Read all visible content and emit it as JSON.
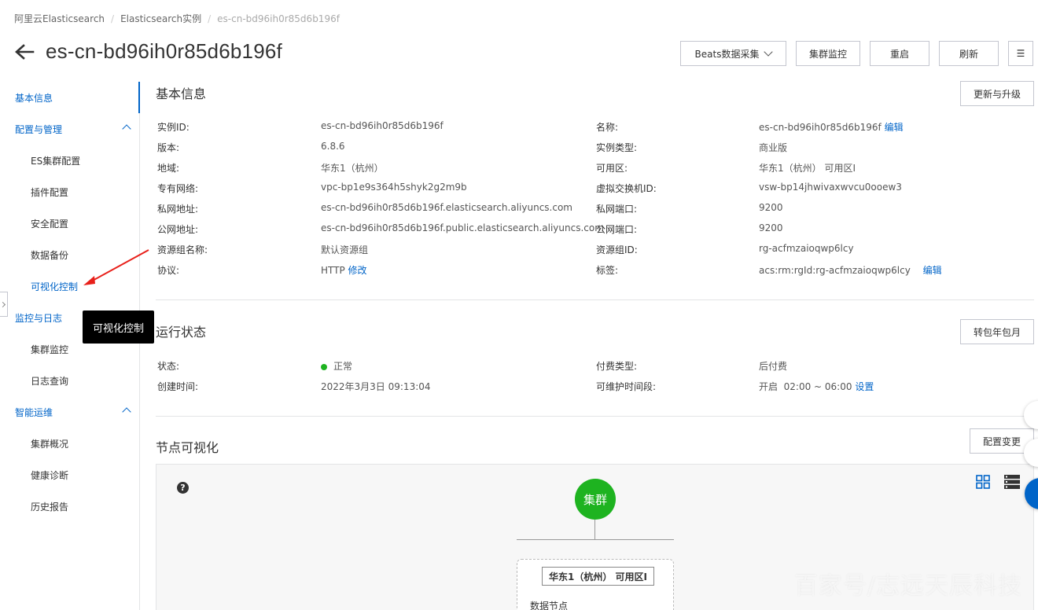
{
  "breadcrumb": [
    "阿里云Elasticsearch",
    "Elasticsearch实例",
    "es-cn-bd96ih0r85d6b196f"
  ],
  "title": "es-cn-bd96ih0r85d6b196f",
  "toolbar": {
    "beats": "Beats数据采集",
    "monitor": "集群监控",
    "restart": "重启",
    "refresh": "刷新",
    "menu_icon": "☰"
  },
  "sidebar": {
    "basic": "基本信息",
    "config_group": "配置与管理",
    "config_items": [
      "ES集群配置",
      "插件配置",
      "安全配置",
      "数据备份",
      "可视化控制"
    ],
    "monitor_group": "监控与日志",
    "monitor_items": [
      "集群监控",
      "日志查询"
    ],
    "ops_group": "智能运维",
    "ops_items": [
      "集群概况",
      "健康诊断",
      "历史报告"
    ]
  },
  "tooltip": "可视化控制",
  "basic_info": {
    "title": "基本信息",
    "upgrade_button": "更新与升级",
    "left": [
      {
        "label": "实例ID:",
        "value": "es-cn-bd96ih0r85d6b196f"
      },
      {
        "label": "版本:",
        "value": "6.8.6"
      },
      {
        "label": "地域:",
        "value": "华东1（杭州）"
      },
      {
        "label": "专有网络:",
        "value": "vpc-bp1e9s364h5shyk2g2m9b"
      },
      {
        "label": "私网地址:",
        "value": "es-cn-bd96ih0r85d6b196f.elasticsearch.aliyuncs.com"
      },
      {
        "label": "公网地址:",
        "value": "es-cn-bd96ih0r85d6b196f.public.elasticsearch.aliyuncs.com"
      },
      {
        "label": "资源组名称:",
        "value": "默认资源组"
      },
      {
        "label": "协议:",
        "value": "HTTP",
        "link": "修改"
      }
    ],
    "right": [
      {
        "label": "名称:",
        "value": "es-cn-bd96ih0r85d6b196f",
        "link": "编辑"
      },
      {
        "label": "实例类型:",
        "value": "商业版"
      },
      {
        "label": "可用区:",
        "value": "华东1（杭州） 可用区I"
      },
      {
        "label": "虚拟交换机ID:",
        "value": "vsw-bp14jhwivaxwvcu0ooew3"
      },
      {
        "label": "私网端口:",
        "value": "9200"
      },
      {
        "label": "公网端口:",
        "value": "9200"
      },
      {
        "label": "资源组ID:",
        "value": "rg-acfmzaioqwp6lcy"
      },
      {
        "label": "标签:",
        "value": "acs:rm:rgId:rg-acfmzaioqwp6lcy",
        "link": "编辑"
      }
    ]
  },
  "run_status": {
    "title": "运行状态",
    "button": "转包年包月",
    "status_label": "状态:",
    "status_value": "正常",
    "created_label": "创建时间:",
    "created_value": "2022年3月3日 09:13:04",
    "pay_label": "付费类型:",
    "pay_value": "后付费",
    "maint_label": "可维护时间段:",
    "maint_value": "开启  02:00 ~ 06:00",
    "maint_link": "设置",
    "status_color": "#1eb320"
  },
  "node_viz": {
    "title": "节点可视化",
    "button": "配置变更",
    "cluster": "集群",
    "zone": "华东1（杭州） 可用区I",
    "data_nodes": "数据节点"
  },
  "watermark": "百家号/志远天辰科技",
  "colors": {
    "accent": "#0064c8",
    "success": "#1eb320"
  }
}
